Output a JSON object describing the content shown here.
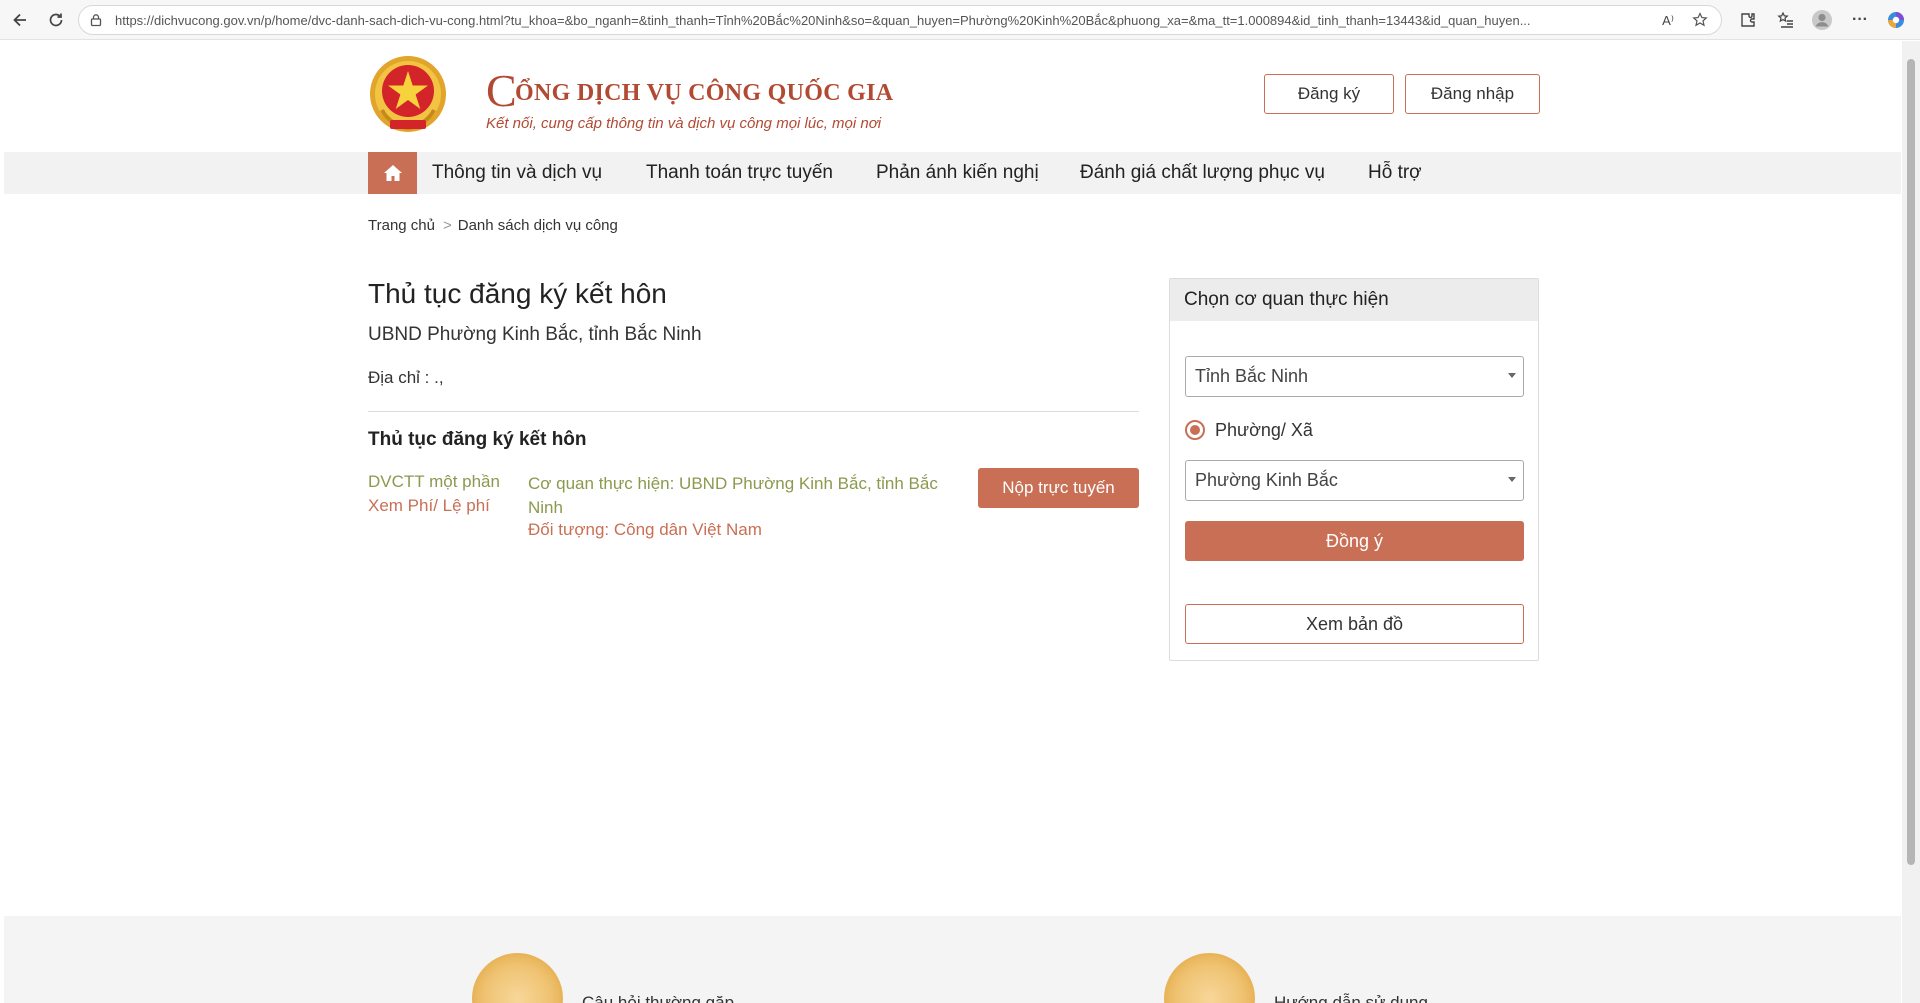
{
  "browser": {
    "url": "https://dichvucong.gov.vn/p/home/dvc-danh-sach-dich-vu-cong.html?tu_khoa=&bo_nganh=&tinh_thanh=Tỉnh%20Bắc%20Ninh&so=&quan_huyen=Phường%20Kinh%20Bắc&phuong_xa=&ma_tt=1.000894&id_tinh_thanh=13443&id_quan_huyen...",
    "reader_icon": "A⁾"
  },
  "header": {
    "title_initial": "C",
    "title_rest": "ỔNG DỊCH VỤ CÔNG QUỐC GIA",
    "slogan": "Kết nối, cung cấp thông tin và dịch vụ công mọi lúc, mọi nơi",
    "register_label": "Đăng ký",
    "login_label": "Đăng nhập"
  },
  "nav": {
    "items": [
      {
        "label": "Thông tin và dịch vụ"
      },
      {
        "label": "Thanh toán trực tuyến"
      },
      {
        "label": "Phản ánh kiến nghị"
      },
      {
        "label": "Đánh giá chất lượng phục vụ"
      },
      {
        "label": "Hỗ trợ"
      }
    ]
  },
  "breadcrumb": {
    "home": "Trang chủ",
    "separator": ">",
    "current": "Danh sách dịch vụ công"
  },
  "main": {
    "title": "Thủ tục đăng ký kết hôn",
    "agency": "UBND Phường Kinh Bắc, tỉnh Bắc Ninh",
    "address": "Địa chỉ : .,",
    "procedure": {
      "name": "Thủ tục đăng ký kết hôn",
      "level": "DVCTT một phần",
      "fee_link": "Xem Phí/ Lệ phí",
      "exec_agency": "Cơ quan thực hiện: UBND Phường Kinh Bắc, tỉnh Bắc Ninh",
      "target": "Đối tượng: Công dân Việt Nam",
      "submit_label": "Nộp trực tuyến"
    }
  },
  "side_panel": {
    "heading": "Chọn cơ quan thực hiện",
    "province": "Tỉnh Bắc Ninh",
    "radio_label": "Phường/ Xã",
    "radio_checked": true,
    "ward": "Phường Kinh Bắc",
    "agree_label": "Đồng ý",
    "map_label": "Xem bản đồ"
  },
  "footer": {
    "faq": "Câu hỏi thường gặp",
    "guide": "Hướng dẫn sử dụng"
  },
  "colors": {
    "accent": "#c96f55",
    "brand_text": "#b24a33",
    "level_text": "#8a9a4e"
  }
}
